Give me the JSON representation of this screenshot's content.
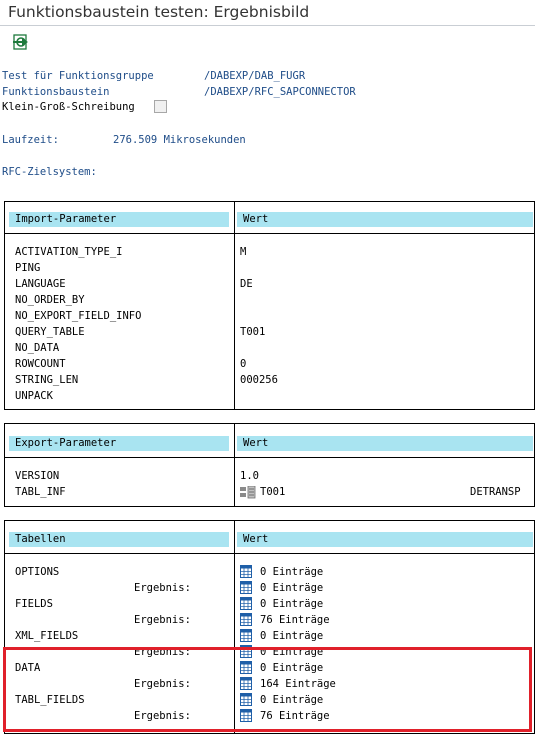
{
  "window": {
    "title": "Funktionsbaustein testen: Ergebnisbild"
  },
  "toolbar": {
    "icon": "execute-icon"
  },
  "info": {
    "test_group_label": "Test für Funktionsgruppe",
    "test_group_value": "/DABEXP/DAB_FUGR",
    "fb_label": "Funktionsbaustein",
    "fb_value": "/DABEXP/RFC_SAPCONNECTOR",
    "case_label": "Klein-Groß-Schreibung",
    "runtime_label": "Laufzeit:",
    "runtime_value": "276.509 Mikrosekunden",
    "rfc_label": "RFC-Zielsystem:"
  },
  "import": {
    "header_param": "Import-Parameter",
    "header_value": "Wert",
    "rows": [
      {
        "name": "ACTIVATION_TYPE_I",
        "value": "M"
      },
      {
        "name": "PING",
        "value": ""
      },
      {
        "name": "LANGUAGE",
        "value": "DE"
      },
      {
        "name": "NO_ORDER_BY",
        "value": ""
      },
      {
        "name": "NO_EXPORT_FIELD_INFO",
        "value": ""
      },
      {
        "name": "QUERY_TABLE",
        "value": "T001"
      },
      {
        "name": "NO_DATA",
        "value": ""
      },
      {
        "name": "ROWCOUNT",
        "value": "0"
      },
      {
        "name": "STRING_LEN",
        "value": "000256"
      },
      {
        "name": "UNPACK",
        "value": ""
      }
    ]
  },
  "export": {
    "header_param": "Export-Parameter",
    "header_value": "Wert",
    "version_name": "VERSION",
    "version_value": "1.0",
    "tabl_inf_name": "TABL_INF",
    "tabl_inf_value": "T001",
    "tabl_inf_extra": "DETRANSP"
  },
  "tables": {
    "header_param": "Tabellen",
    "header_value": "Wert",
    "result_label": "Ergebnis:",
    "rows": [
      {
        "name": "OPTIONS",
        "before": "0 Einträge",
        "after": "0 Einträge"
      },
      {
        "name": "FIELDS",
        "before": "0 Einträge",
        "after": "76 Einträge"
      },
      {
        "name": "XML_FIELDS",
        "before": "0 Einträge",
        "after": "0 Einträge"
      },
      {
        "name": "DATA",
        "before": "0 Einträge",
        "after": "164 Einträge"
      },
      {
        "name": "TABL_FIELDS",
        "before": "0 Einträge",
        "after": "76 Einträge"
      }
    ]
  },
  "colors": {
    "header_bg": "#a9e4f1",
    "highlight": "#e0202a",
    "label_blue": "#1e4c88"
  }
}
